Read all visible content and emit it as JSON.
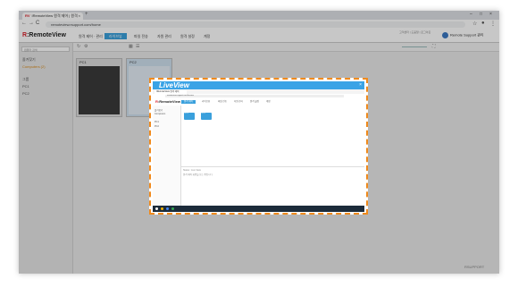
{
  "browser": {
    "tab_title": "IRemoteView 원격 제어 | 원격",
    "tab_logo": "RV",
    "tab_close": "×",
    "new_tab": "+",
    "url": "remoteview.rsupport.com/home",
    "window_controls": [
      "–",
      "□",
      "×"
    ],
    "nav": [
      "←",
      "→",
      "C"
    ],
    "address_actions": [
      "☆",
      "●",
      "⋮"
    ]
  },
  "app": {
    "logo_prefix": "R",
    "logo_text": ":RemoteView",
    "menu": [
      {
        "label": "원격 제어 · 관리"
      },
      {
        "label": "라이브뷰",
        "active": true
      },
      {
        "label": "파일 전송"
      },
      {
        "label": "자원 관리"
      },
      {
        "label": "원격 설정"
      },
      {
        "label": "계정"
      }
    ],
    "user_name": "Remote Support 관리",
    "top_right_links": "고객센터 | 도움말 | 로그아웃"
  },
  "sidebar": {
    "search_placeholder": "컴퓨터 검색",
    "items": [
      {
        "label": "즐겨찾기"
      },
      {
        "label": "Computers (2)"
      },
      {
        "label": "그룹"
      },
      {
        "label": "PC1"
      },
      {
        "label": "PC2"
      }
    ]
  },
  "thumbnails": [
    {
      "label": "PC1",
      "theme": "dark"
    },
    {
      "label": "PC2",
      "theme": "light"
    }
  ],
  "liveview": {
    "title": "LiveView",
    "close": "×",
    "mini": {
      "tab_title": "IRemoteView 원격 제어",
      "url": "remoteview.rsupport.com/liveview",
      "logo_prefix": "R",
      "logo_text": ":RemoteView",
      "menu": [
        "원격 제어",
        "라이브뷰",
        "파일 전송",
        "자원 관리",
        "원격 설정",
        "계정"
      ],
      "sidebar_items": [
        "즐겨찾기",
        "Computers",
        "PC1",
        "PC2"
      ],
      "cards": [
        "PC1",
        "PC2"
      ],
      "footer_text": "Status : Live View",
      "footer_text2": "원격 제어 화면을 보는 중입니다"
    }
  },
  "brand": "RSUPPORT"
}
